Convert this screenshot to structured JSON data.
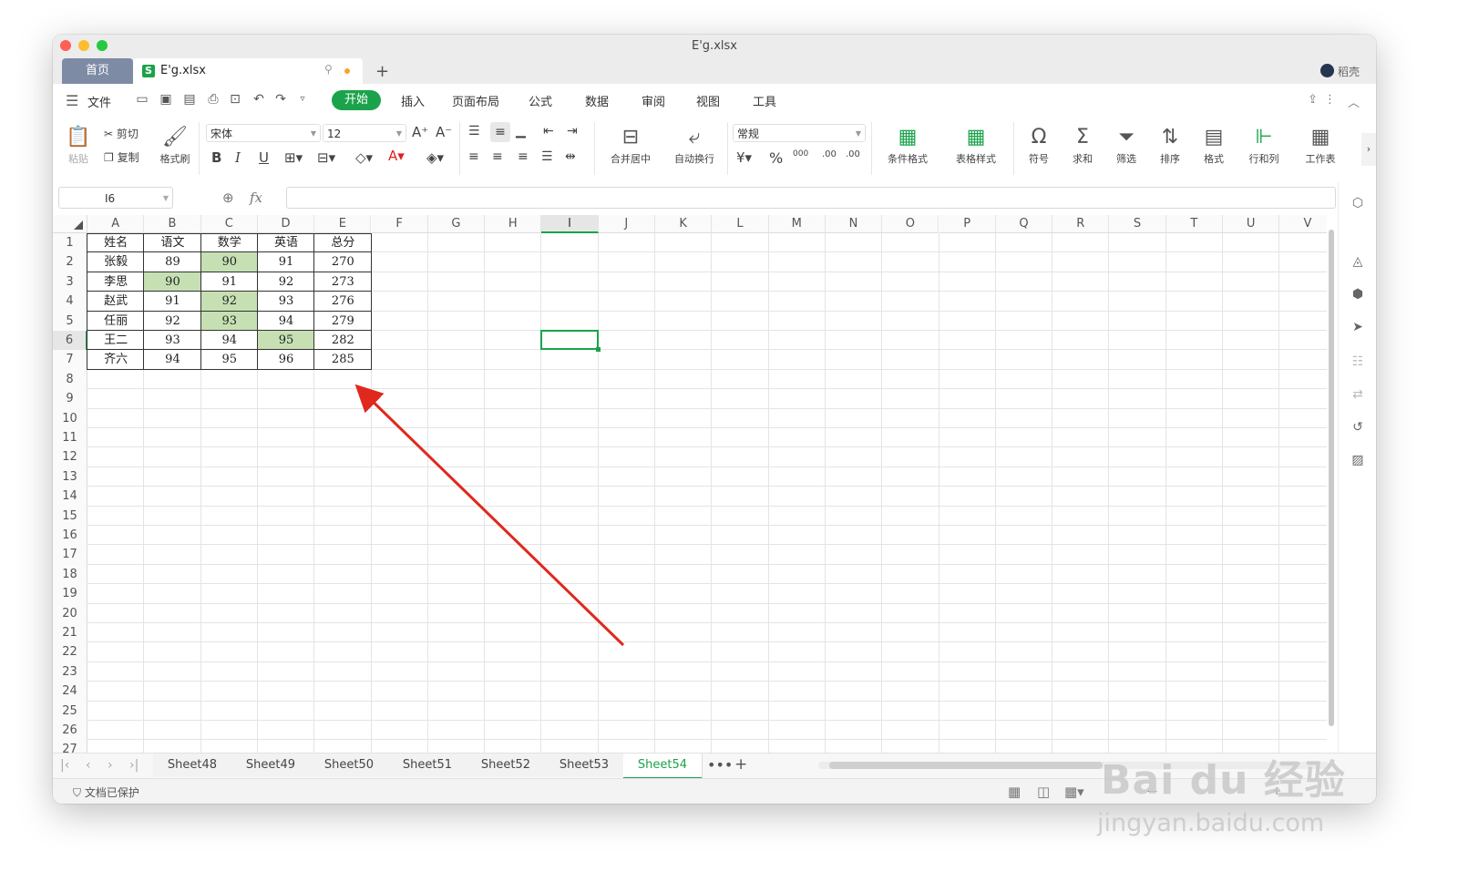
{
  "window": {
    "title": "E'g.xlsx"
  },
  "tabs": {
    "home": "首页",
    "file": "E'g.xlsx",
    "file_icon": "S",
    "add": "+"
  },
  "user": {
    "name": "稻壳"
  },
  "menubar": {
    "file": "文件",
    "items": [
      "开始",
      "插入",
      "页面布局",
      "公式",
      "数据",
      "审阅",
      "视图",
      "工具"
    ]
  },
  "ribbon": {
    "paste": "粘贴",
    "cut": "剪切",
    "copy": "复制",
    "format_painter": "格式刷",
    "font_name": "宋体",
    "font_size": "12",
    "merge_center": "合并居中",
    "wrap_text": "自动换行",
    "number_format": "常规",
    "percent": "%",
    "thousands": "000",
    "inc_decimal": ".00",
    "dec_decimal": ".00",
    "conditional_format": "条件格式",
    "table_style": "表格样式",
    "symbol": "符号",
    "sum": "求和",
    "filter": "筛选",
    "sort": "排序",
    "format": "格式",
    "rows_cols": "行和列",
    "worksheet": "工作表"
  },
  "formula_bar": {
    "name_box": "I6",
    "fx": "fx",
    "value": ""
  },
  "grid": {
    "columns": [
      "A",
      "B",
      "C",
      "D",
      "E",
      "F",
      "G",
      "H",
      "I",
      "J",
      "K",
      "L",
      "M",
      "N",
      "O",
      "P",
      "Q",
      "R",
      "S",
      "T",
      "U",
      "V"
    ],
    "active_column": "I",
    "active_row": 6,
    "rows": [
      "1",
      "2",
      "3",
      "4",
      "5",
      "6",
      "7",
      "8",
      "9",
      "10",
      "11",
      "12",
      "13",
      "14",
      "15",
      "16",
      "17",
      "18",
      "19",
      "20",
      "21",
      "22",
      "23",
      "24",
      "25",
      "26",
      "27"
    ],
    "table": [
      [
        "姓名",
        "语文",
        "数学",
        "英语",
        "总分"
      ],
      [
        "张毅",
        "89",
        "90",
        "91",
        "270"
      ],
      [
        "李思",
        "90",
        "91",
        "92",
        "273"
      ],
      [
        "赵武",
        "91",
        "92",
        "93",
        "276"
      ],
      [
        "任丽",
        "92",
        "93",
        "94",
        "279"
      ],
      [
        "王二",
        "93",
        "94",
        "95",
        "282"
      ],
      [
        "齐六",
        "94",
        "95",
        "96",
        "285"
      ]
    ],
    "highlighted_cells": [
      "C2",
      "B3",
      "C4",
      "C5",
      "D6"
    ],
    "highlight_color": "#c6e0b4"
  },
  "sheets": {
    "tabs": [
      "Sheet48",
      "Sheet49",
      "Sheet50",
      "Sheet51",
      "Sheet52",
      "Sheet53",
      "Sheet54"
    ],
    "active": "Sheet54",
    "more": "•••",
    "add": "+"
  },
  "status": {
    "protected": "文档已保护"
  },
  "annotation": {
    "arrow_color": "#e0281e"
  },
  "watermark": {
    "logo": "Bai du 经验",
    "url": "jingyan.baidu.com"
  },
  "colors": {
    "accent": "#1aa34a",
    "home_tab": "#7d8ba4"
  }
}
